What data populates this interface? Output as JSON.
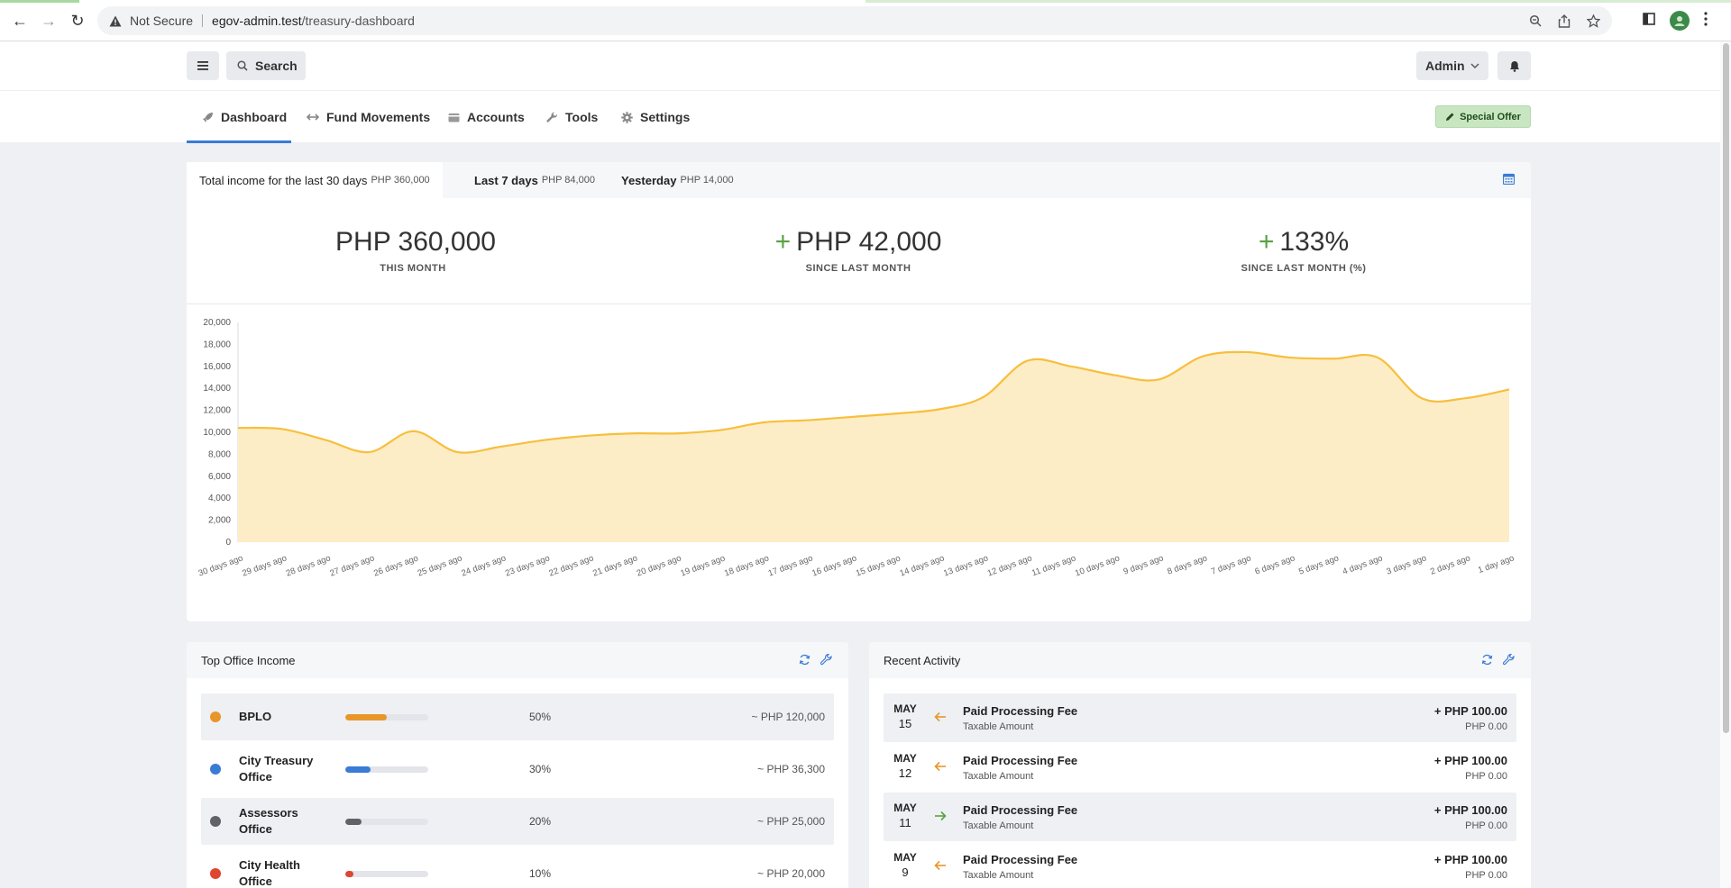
{
  "browser": {
    "security_label": "Not Secure",
    "url_host": "egov-admin.test",
    "url_path": "/treasury-dashboard"
  },
  "header": {
    "search_label": "Search",
    "user_label": "Admin"
  },
  "nav": {
    "tabs": [
      {
        "label": "Dashboard",
        "icon": "rocket-icon"
      },
      {
        "label": "Fund Movements",
        "icon": "arrows-horizontal-icon"
      },
      {
        "label": "Accounts",
        "icon": "wallet-icon"
      },
      {
        "label": "Tools",
        "icon": "wrench-icon"
      },
      {
        "label": "Settings",
        "icon": "gear-icon"
      }
    ],
    "special_offer": "Special Offer"
  },
  "income": {
    "tabs": [
      {
        "label": "Total income for the last 30 days",
        "amount": "PHP 360,000"
      },
      {
        "label": "Last 7 days",
        "amount": "PHP 84,000"
      },
      {
        "label": "Yesterday",
        "amount": "PHP 14,000"
      }
    ],
    "stats": [
      {
        "prefix": "",
        "value": "PHP 360,000",
        "label": "THIS MONTH"
      },
      {
        "prefix": "+",
        "value": "PHP 42,000",
        "label": "SINCE LAST MONTH"
      },
      {
        "prefix": "+",
        "value": "133%",
        "label": "SINCE LAST MONTH (%)"
      }
    ]
  },
  "chart_data": {
    "type": "area",
    "x": [
      "30 days ago",
      "29 days ago",
      "28 days ago",
      "27 days ago",
      "26 days ago",
      "25 days ago",
      "24 days ago",
      "23 days ago",
      "22 days ago",
      "21 days ago",
      "20 days ago",
      "19 days ago",
      "18 days ago",
      "17 days ago",
      "16 days ago",
      "15 days ago",
      "14 days ago",
      "13 days ago",
      "12 days ago",
      "11 days ago",
      "10 days ago",
      "9 days ago",
      "8 days ago",
      "7 days ago",
      "6 days ago",
      "5 days ago",
      "4 days ago",
      "3 days ago",
      "2 days ago",
      "1 day ago"
    ],
    "series": [
      {
        "values": [
          10400,
          10300,
          9300,
          8200,
          10100,
          8200,
          8700,
          9300,
          9700,
          9900,
          9900,
          10200,
          10900,
          11100,
          11400,
          11700,
          12100,
          13200,
          16500,
          16000,
          15200,
          14800,
          16900,
          17300,
          16800,
          16700,
          16800,
          13100,
          13100,
          13900
        ]
      }
    ],
    "ylim": [
      0,
      20000
    ],
    "yticks": [
      "0",
      "2,000",
      "4,000",
      "6,000",
      "8,000",
      "10,000",
      "12,000",
      "14,000",
      "16,000",
      "18,000",
      "20,000"
    ],
    "colors": {
      "line": "#f7bf3e",
      "fill": "#fdedc6"
    },
    "grid": false
  },
  "top_office": {
    "title": "Top Office Income",
    "rows": [
      {
        "name": "BPLO",
        "pct": "50%",
        "fraction": 0.5,
        "amount": "~ PHP 120,000",
        "color": "#e8962a"
      },
      {
        "name": "City Treasury Office",
        "pct": "30%",
        "fraction": 0.3,
        "amount": "~ PHP 36,300",
        "color": "#3a7bd5"
      },
      {
        "name": "Assessors Office",
        "pct": "20%",
        "fraction": 0.2,
        "amount": "~ PHP 25,000",
        "color": "#5f6368"
      },
      {
        "name": "City Health Office",
        "pct": "10%",
        "fraction": 0.1,
        "amount": "~ PHP 20,000",
        "color": "#e0462f"
      }
    ]
  },
  "recent_activity": {
    "title": "Recent Activity",
    "rows": [
      {
        "month": "MAY",
        "day": "15",
        "direction": "in",
        "title": "Paid Processing Fee",
        "sub": "Taxable Amount",
        "amount": "+ PHP 100.00",
        "tax": "PHP 0.00"
      },
      {
        "month": "MAY",
        "day": "12",
        "direction": "in",
        "title": "Paid Processing Fee",
        "sub": "Taxable Amount",
        "amount": "+ PHP 100.00",
        "tax": "PHP 0.00"
      },
      {
        "month": "MAY",
        "day": "11",
        "direction": "out",
        "title": "Paid Processing Fee",
        "sub": "Taxable Amount",
        "amount": "+ PHP 100.00",
        "tax": "PHP 0.00"
      },
      {
        "month": "MAY",
        "day": "9",
        "direction": "in",
        "title": "Paid Processing Fee",
        "sub": "Taxable Amount",
        "amount": "+ PHP 100.00",
        "tax": "PHP 0.00"
      }
    ]
  }
}
